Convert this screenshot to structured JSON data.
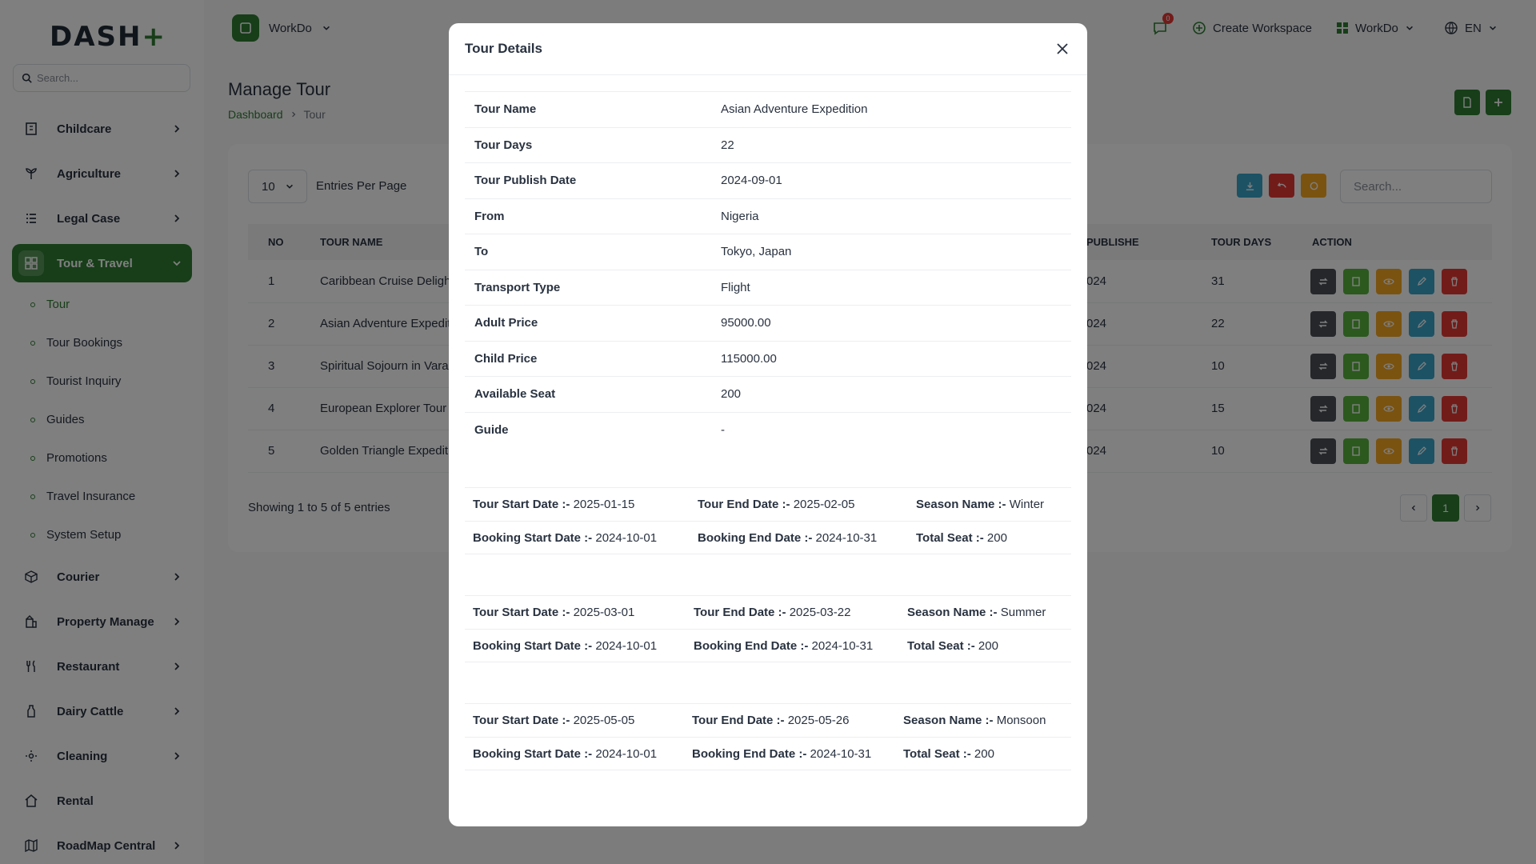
{
  "brand": {
    "logo_main": "DASH",
    "logo_accent": "+"
  },
  "sidebar": {
    "search_placeholder": "Search...",
    "items": [
      {
        "label": "Childcare",
        "icon": "building-icon"
      },
      {
        "label": "Agriculture",
        "icon": "plant-icon"
      },
      {
        "label": "Legal Case",
        "icon": "list-icon"
      },
      {
        "label": "Tour & Travel",
        "icon": "grid-icon"
      },
      {
        "label": "Courier",
        "icon": "box-icon"
      },
      {
        "label": "Property Manage",
        "icon": "property-icon"
      },
      {
        "label": "Restaurant",
        "icon": "utensils-icon"
      },
      {
        "label": "Dairy Cattle",
        "icon": "bottle-icon"
      },
      {
        "label": "Cleaning",
        "icon": "sparkle-icon"
      },
      {
        "label": "Rental",
        "icon": "home-icon"
      },
      {
        "label": "RoadMap Central",
        "icon": "map-icon"
      }
    ],
    "subitems": [
      "Tour",
      "Tour Bookings",
      "Tourist Inquiry",
      "Guides",
      "Promotions",
      "Travel Insurance",
      "System Setup"
    ]
  },
  "header": {
    "workspace": "WorkDo",
    "notification_count": "0",
    "create_workspace": "Create Workspace",
    "workspace_menu": "WorkDo",
    "language": "EN"
  },
  "page": {
    "title": "Manage Tour",
    "breadcrumb": [
      "Dashboard",
      "Tour"
    ]
  },
  "table": {
    "entries_value": "10",
    "entries_label": "Entries Per Page",
    "search_placeholder": "Search...",
    "columns": [
      "NO",
      "TOUR NAME",
      "PUBLISHE",
      "TOUR DAYS",
      "ACTION"
    ],
    "rows": [
      {
        "no": "1",
        "name": "Caribbean Cruise Delight",
        "publish": "024",
        "days": "31"
      },
      {
        "no": "2",
        "name": "Asian Adventure Expediti",
        "publish": "024",
        "days": "22"
      },
      {
        "no": "3",
        "name": "Spiritual Sojourn in Varar",
        "publish": "024",
        "days": "10"
      },
      {
        "no": "4",
        "name": "European Explorer Tour",
        "publish": "024",
        "days": "15"
      },
      {
        "no": "5",
        "name": "Golden Triangle Expeditic",
        "publish": "024",
        "days": "10"
      }
    ],
    "showing": "Showing 1 to 5 of 5 entries",
    "page": "1"
  },
  "modal": {
    "title": "Tour Details",
    "details": [
      {
        "key": "Tour Name",
        "value": "Asian Adventure Expedition"
      },
      {
        "key": "Tour Days",
        "value": "22"
      },
      {
        "key": "Tour Publish Date",
        "value": "2024-09-01"
      },
      {
        "key": "From",
        "value": "Nigeria"
      },
      {
        "key": "To",
        "value": "Tokyo, Japan"
      },
      {
        "key": "Transport Type",
        "value": "Flight"
      },
      {
        "key": "Adult Price",
        "value": "95000.00"
      },
      {
        "key": "Child Price",
        "value": "115000.00"
      },
      {
        "key": "Available Seat",
        "value": "200"
      },
      {
        "key": "Guide",
        "value": "-"
      }
    ],
    "labels": {
      "tour_start": "Tour Start Date :-",
      "tour_end": "Tour End Date :-",
      "season": "Season Name :-",
      "booking_start": "Booking Start Date :-",
      "booking_end": "Booking End Date :-",
      "total_seat": "Total Seat :-"
    },
    "schedules": [
      {
        "tour_start": "2025-01-15",
        "tour_end": "2025-02-05",
        "season": "Winter",
        "booking_start": "2024-10-01",
        "booking_end": "2024-10-31",
        "total_seat": "200"
      },
      {
        "tour_start": "2025-03-01",
        "tour_end": "2025-03-22",
        "season": "Summer",
        "booking_start": "2024-10-01",
        "booking_end": "2024-10-31",
        "total_seat": "200"
      },
      {
        "tour_start": "2025-05-05",
        "tour_end": "2025-05-26",
        "season": "Monsoon",
        "booking_start": "2024-10-01",
        "booking_end": "2024-10-31",
        "total_seat": "200"
      }
    ]
  },
  "colors": {
    "brand_green": "#2f7d32",
    "danger": "#e53935",
    "warning": "#f5a623",
    "info": "#3ba4c8",
    "dark": "#4a4f55",
    "success": "#58b33c"
  }
}
